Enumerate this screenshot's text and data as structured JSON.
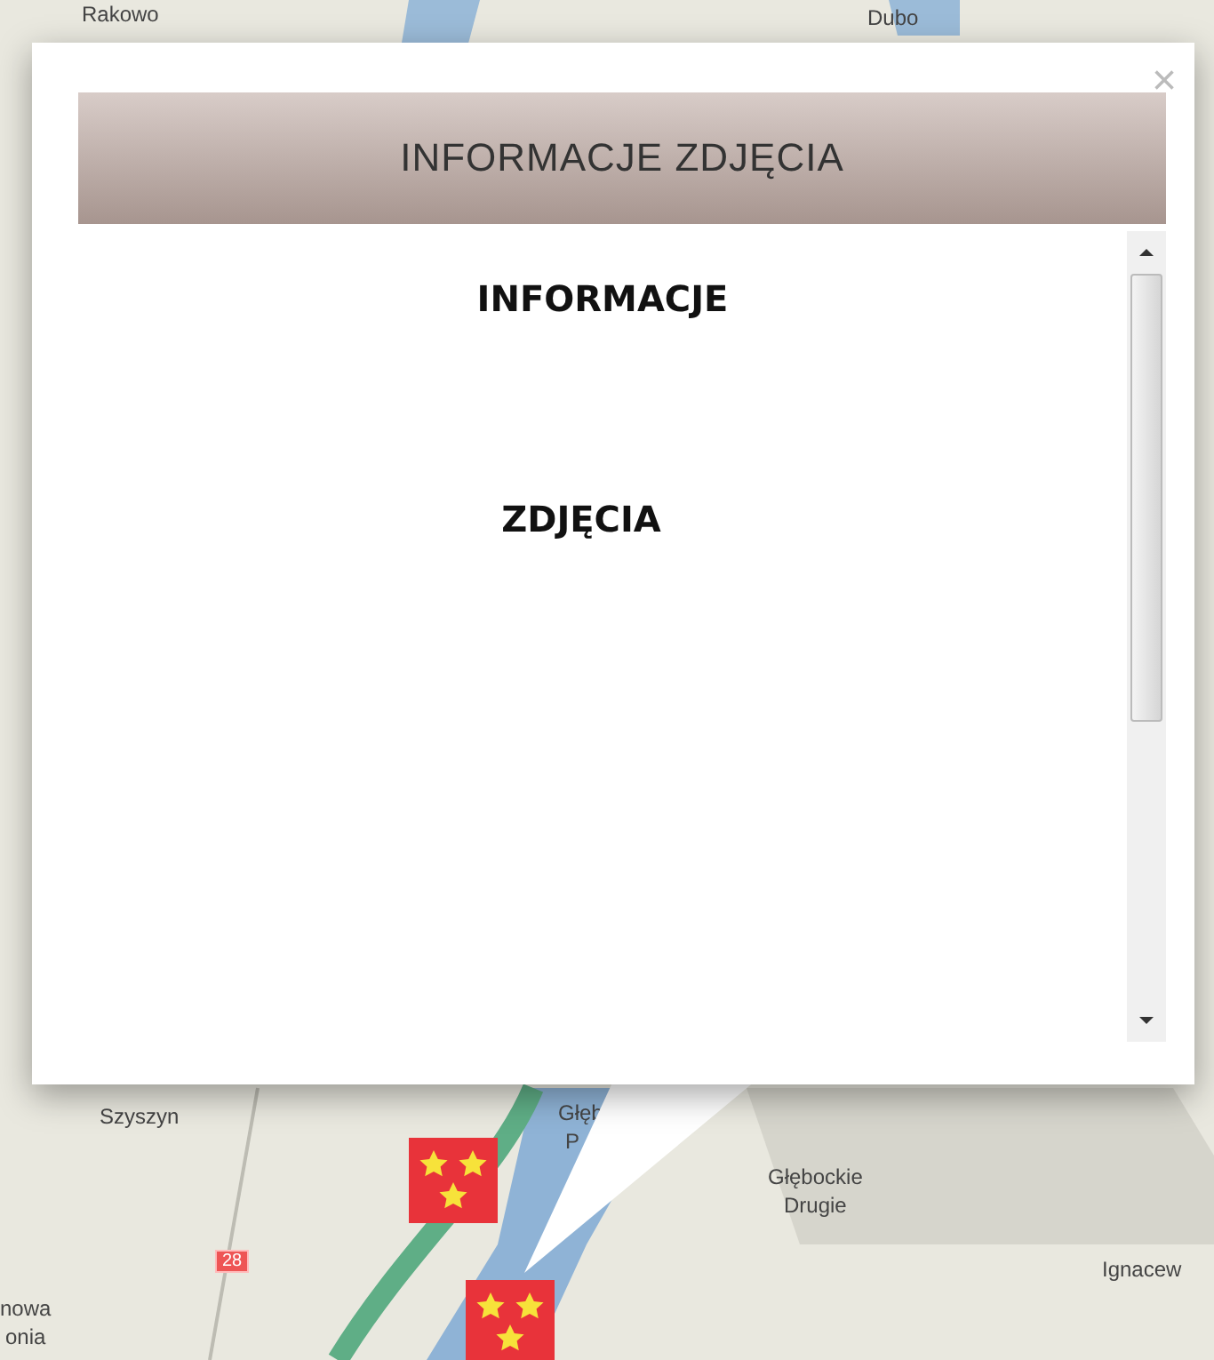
{
  "map": {
    "labels": [
      {
        "text": "Rakowo"
      },
      {
        "text": "Dubo"
      },
      {
        "text": "Szyszyn"
      },
      {
        "text": "Głęb"
      },
      {
        "text": "P"
      },
      {
        "text": "Głębockie\nDrugie"
      },
      {
        "text": "Ignacew"
      },
      {
        "text": "nowa\nonia"
      }
    ],
    "road_sign": "28"
  },
  "popup": {
    "title": "INFORMACJE ZDJĘCIA",
    "close": "×",
    "sections": [
      "INFORMACJE",
      "ZDJĘCIA"
    ]
  }
}
